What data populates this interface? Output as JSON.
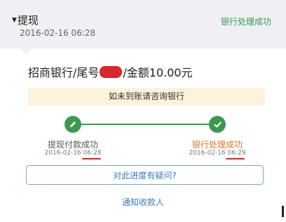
{
  "header": {
    "title": "提现",
    "datetime": "2016-02-16 06:28",
    "status": "银行处理成功",
    "background": "#efeff4"
  },
  "account": {
    "bank_prefix": "招商银行/尾号",
    "masked_suffix": "",
    "amount_text": "/金额10.00元"
  },
  "notice": {
    "text": "如未到账请咨询银行",
    "background": "#fcf3da"
  },
  "progress": {
    "accent_color": "#3a9a4e",
    "steps": [
      {
        "label": "提现付款成功",
        "time": "2016-02-16 06:28",
        "icon": "pencil-icon",
        "color": "#555555"
      },
      {
        "label": "银行处理成功",
        "time": "2016-02-16 06:29",
        "icon": "check-icon",
        "color": "#e8702a"
      }
    ]
  },
  "actions": {
    "question_label": "对此进度有疑问?",
    "notify_label": "通知收款人",
    "link_color": "#3a7cc4"
  }
}
